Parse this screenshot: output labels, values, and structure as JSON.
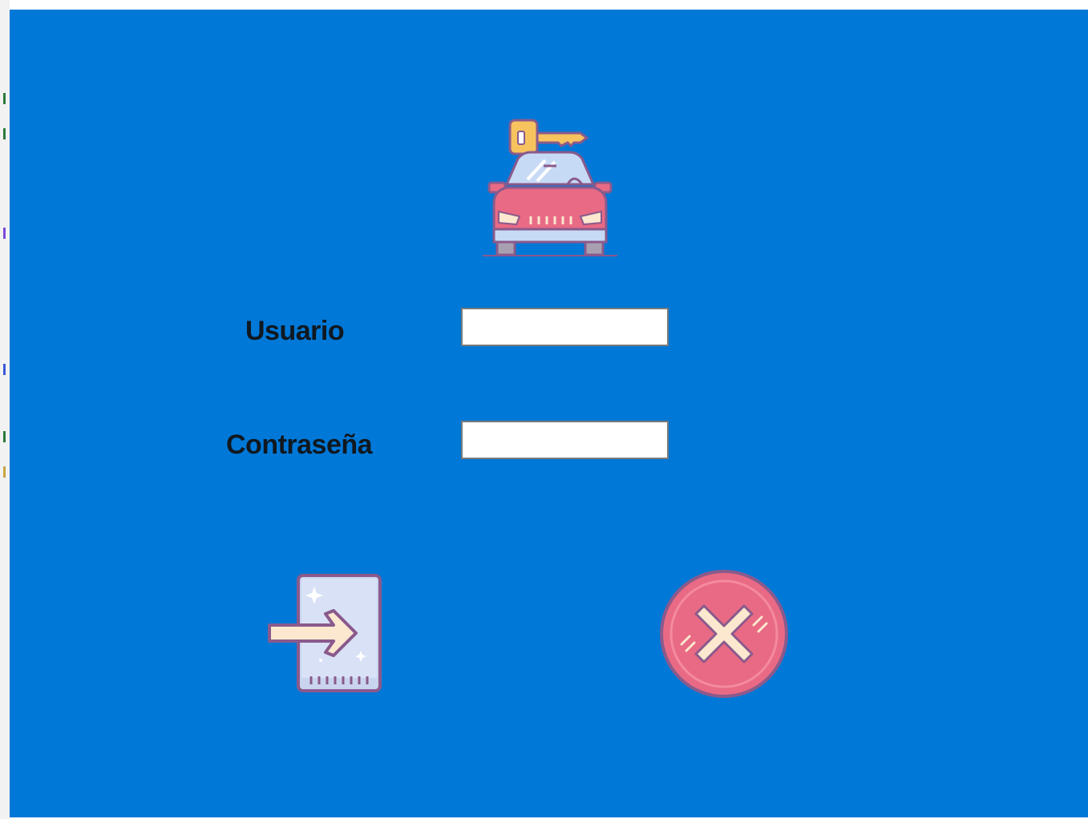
{
  "window": {
    "background_color": "#0078d7"
  },
  "logo": {
    "icon": "car-key-icon"
  },
  "form": {
    "username": {
      "label": "Usuario",
      "value": "",
      "placeholder": ""
    },
    "password": {
      "label": "Contraseña",
      "value": "",
      "placeholder": ""
    }
  },
  "buttons": {
    "login": {
      "icon": "login-door-icon"
    },
    "cancel": {
      "icon": "close-circle-icon"
    }
  },
  "colors": {
    "accent_pink": "#e96a84",
    "outline_purple": "#8a5a8c",
    "key_yellow": "#f6c35f",
    "glass_blue": "#c7daf5",
    "cream": "#fbe8cf"
  }
}
